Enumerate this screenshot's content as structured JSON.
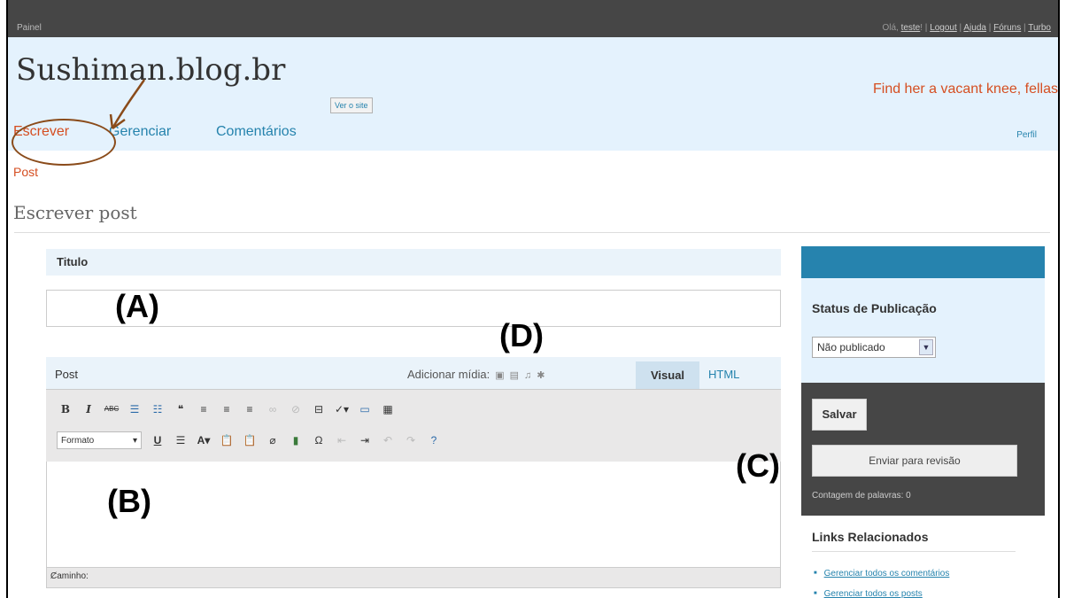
{
  "topbar": {
    "painel": "Painel",
    "greeting": "Olá, ",
    "user": "teste",
    "sep1": "! | ",
    "logout": "Logout",
    "sep2": " | ",
    "ajuda": "Ajuda",
    "sep3": " | ",
    "foruns": "Fóruns",
    "sep4": " | ",
    "turbo": "Turbo"
  },
  "header": {
    "site_title": "Sushiman.blog.br",
    "view_site": "Ver o site",
    "tagline": "Find her a vacant knee, fellas"
  },
  "nav": {
    "escrever": "Escrever",
    "gerenciar": "Gerenciar",
    "comentarios": "Comentários",
    "perfil": "Perfil"
  },
  "subnav": {
    "post": "Post"
  },
  "page": {
    "title": "Escrever post"
  },
  "title_box": {
    "label": "Titulo",
    "value": ""
  },
  "post_box": {
    "label": "Post",
    "media_label": "Adicionar mídia:",
    "tab_visual": "Visual",
    "tab_html": "HTML",
    "format_select": "Formato",
    "path_label": "Caminho:"
  },
  "annotations": {
    "a": "(A)",
    "b": "(B)",
    "c": "(C)",
    "d": "(D)"
  },
  "sidebar": {
    "status_heading": "Status de Publicação",
    "status_value": "Não publicado",
    "save": "Salvar",
    "submit_review": "Enviar para revisão",
    "word_count": "Contagem de palavras: 0",
    "links_heading": "Links Relacionados",
    "links": [
      "Gerenciar todos os comentários",
      "Gerenciar todos os posts"
    ]
  },
  "colors": {
    "accent_orange": "#d54e21",
    "link_blue": "#2583ad",
    "header_bg": "#e4f2fd",
    "dark_bar": "#464646",
    "annotation_brown": "#8a4b1a"
  }
}
